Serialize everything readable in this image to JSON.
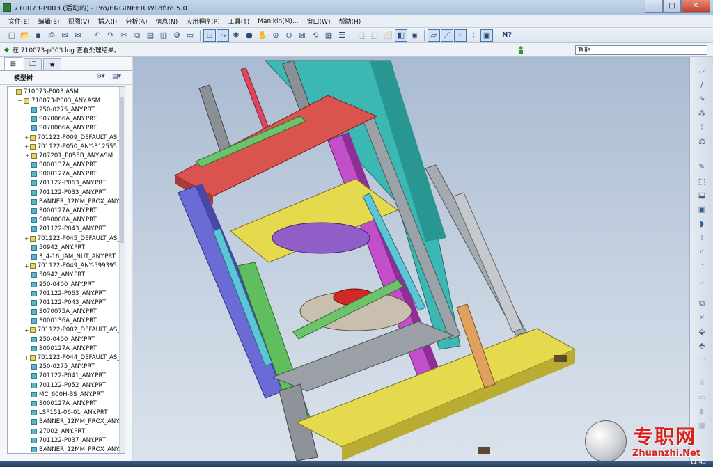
{
  "window": {
    "title": "710073-P003 (活动的) - Pro/ENGINEER Wildfire 5.0",
    "min_label": "–",
    "max_label": "□",
    "close_label": "✕"
  },
  "menu": {
    "items": [
      "文件(E)",
      "编辑(E)",
      "视图(V)",
      "插入(I)",
      "分析(A)",
      "信息(N)",
      "应用程序(P)",
      "工具(T)",
      "Manikin(M)...",
      "窗口(W)",
      "帮助(H)"
    ]
  },
  "toolbar": {
    "icons": [
      "new-icon",
      "open-icon",
      "save-icon",
      "print-icon",
      "email-icon",
      "email-link-icon",
      "undo-icon",
      "redo-icon",
      "cut-icon",
      "copy-icon",
      "paste-icon",
      "paste-special-icon",
      "regenerate-icon",
      "window-icon",
      "spin-center-icon",
      "repaint-icon",
      "orient-icon",
      "pan-icon",
      "zoom-in-icon",
      "zoom-out-icon",
      "refit-icon",
      "reorient-icon",
      "saved-views-icon",
      "layers-icon",
      "wireframe-icon",
      "hidden-line-icon",
      "no-hidden-icon",
      "shading-icon",
      "enhanced-realism-icon",
      "datum-plane-icon",
      "datum-axis-icon",
      "datum-point-icon",
      "csys-icon",
      "annotation-icon"
    ],
    "help_label": "N?"
  },
  "status": {
    "message": "在 710073-p003.log 查看处理结果。",
    "filter_value": "智能",
    "indicator_color": "#2a9a2a"
  },
  "navigator": {
    "tabs": [
      "model-tree-tab-icon",
      "folder-browser-tab-icon",
      "favorites-tab-icon"
    ],
    "header_label": "模型树",
    "settings_label": "⚙▾",
    "show_label": "▤▾"
  },
  "tree": {
    "rows": [
      {
        "label": "710073-P003.ASM",
        "type": "asm",
        "level": 0,
        "exp": ""
      },
      {
        "label": "710073-P003_ANY.ASM",
        "type": "asm",
        "level": 1,
        "exp": "−"
      },
      {
        "label": "250-0275_ANY.PRT",
        "type": "part",
        "level": 2,
        "exp": ""
      },
      {
        "label": "S070066A_ANY.PRT",
        "type": "part",
        "level": 2,
        "exp": ""
      },
      {
        "label": "S070066A_ANY.PRT",
        "type": "part",
        "level": 2,
        "exp": ""
      },
      {
        "label": "701122-P009_DEFAULT_AS_MA",
        "type": "asm",
        "level": 2,
        "exp": "+"
      },
      {
        "label": "701122-P050_ANY-312555.AS",
        "type": "asm",
        "level": 2,
        "exp": "+"
      },
      {
        "label": "707201_P055B_ANY.ASM",
        "type": "asm",
        "level": 2,
        "exp": "+"
      },
      {
        "label": "S000137A_ANY.PRT",
        "type": "part",
        "level": 2,
        "exp": ""
      },
      {
        "label": "S000127A_ANY.PRT",
        "type": "part",
        "level": 2,
        "exp": ""
      },
      {
        "label": "701122-P063_ANY.PRT",
        "type": "part",
        "level": 2,
        "exp": ""
      },
      {
        "label": "701122-P033_ANY.PRT",
        "type": "part",
        "level": 2,
        "exp": ""
      },
      {
        "label": "BANNER_12MM_PROX_ANY.P",
        "type": "part",
        "level": 2,
        "exp": ""
      },
      {
        "label": "S000127A_ANY.PRT",
        "type": "part",
        "level": 2,
        "exp": ""
      },
      {
        "label": "S090008A_ANY.PRT",
        "type": "part",
        "level": 2,
        "exp": ""
      },
      {
        "label": "701122-P043_ANY.PRT",
        "type": "part",
        "level": 2,
        "exp": ""
      },
      {
        "label": "701122-P045_DEFAULT_AS_MA",
        "type": "asm",
        "level": 2,
        "exp": "+"
      },
      {
        "label": "50942_ANY.PRT",
        "type": "part",
        "level": 2,
        "exp": ""
      },
      {
        "label": "3_4-16_JAM_NUT_ANY.PRT",
        "type": "part",
        "level": 2,
        "exp": ""
      },
      {
        "label": "701122-P049_ANY-599395.AS",
        "type": "asm",
        "level": 2,
        "exp": "+"
      },
      {
        "label": "50942_ANY.PRT",
        "type": "part",
        "level": 2,
        "exp": ""
      },
      {
        "label": "250-0400_ANY.PRT",
        "type": "part",
        "level": 2,
        "exp": ""
      },
      {
        "label": "701122-P063_ANY.PRT",
        "type": "part",
        "level": 2,
        "exp": ""
      },
      {
        "label": "701122-P043_ANY.PRT",
        "type": "part",
        "level": 2,
        "exp": ""
      },
      {
        "label": "S070075A_ANY.PRT",
        "type": "part",
        "level": 2,
        "exp": ""
      },
      {
        "label": "S000136A_ANY.PRT",
        "type": "part",
        "level": 2,
        "exp": ""
      },
      {
        "label": "701122-P002_DEFAULT_AS_MA",
        "type": "asm",
        "level": 2,
        "exp": "+"
      },
      {
        "label": "250-0400_ANY.PRT",
        "type": "part",
        "level": 2,
        "exp": ""
      },
      {
        "label": "S000127A_ANY.PRT",
        "type": "part",
        "level": 2,
        "exp": ""
      },
      {
        "label": "701122-P044_DEFAULT_AS_MA",
        "type": "asm",
        "level": 2,
        "exp": "+"
      },
      {
        "label": "250-0275_ANY.PRT",
        "type": "part",
        "level": 2,
        "exp": ""
      },
      {
        "label": "701122-P041_ANY.PRT",
        "type": "part",
        "level": 2,
        "exp": ""
      },
      {
        "label": "701122-P052_ANY.PRT",
        "type": "part",
        "level": 2,
        "exp": ""
      },
      {
        "label": "MC_600H-BS_ANY.PRT",
        "type": "part",
        "level": 2,
        "exp": ""
      },
      {
        "label": "S000127A_ANY.PRT",
        "type": "part",
        "level": 2,
        "exp": ""
      },
      {
        "label": "LSP151-06-01_ANY.PRT",
        "type": "part",
        "level": 2,
        "exp": ""
      },
      {
        "label": "BANNER_12MM_PROX_ANY.P",
        "type": "part",
        "level": 2,
        "exp": ""
      },
      {
        "label": "27002_ANY.PRT",
        "type": "part",
        "level": 2,
        "exp": ""
      },
      {
        "label": "701122-P037_ANY.PRT",
        "type": "part",
        "level": 2,
        "exp": ""
      },
      {
        "label": "BANNER_12MM_PROX_ANY.P",
        "type": "part",
        "level": 2,
        "exp": ""
      }
    ]
  },
  "right_toolbar": {
    "icons": [
      {
        "name": "datum-plane-icon",
        "glyph": "▱"
      },
      {
        "name": "datum-axis-icon",
        "glyph": "/"
      },
      {
        "name": "sketched-curve-icon",
        "glyph": "∿"
      },
      {
        "name": "datum-point-icon",
        "glyph": "⁂"
      },
      {
        "name": "csys-icon",
        "glyph": "⊹"
      },
      {
        "name": "analysis-feature-icon",
        "glyph": "⚖"
      },
      {
        "name": "sketch-icon",
        "glyph": "✎"
      },
      {
        "name": "component-icon",
        "glyph": "⬚"
      },
      {
        "name": "create-component-icon",
        "glyph": "⬓"
      },
      {
        "name": "extrude-icon",
        "glyph": "▣"
      },
      {
        "name": "revolve-icon",
        "glyph": "◗"
      },
      {
        "name": "hole-icon",
        "glyph": "⊤"
      },
      {
        "name": "round-icon",
        "glyph": "◜"
      },
      {
        "name": "chamfer-icon",
        "glyph": "◝"
      },
      {
        "name": "draft-icon",
        "glyph": "◞"
      },
      {
        "name": "pattern-icon",
        "glyph": "⧉"
      },
      {
        "name": "mirror-icon",
        "glyph": "⧖"
      },
      {
        "name": "merge-icon",
        "glyph": "⬙"
      },
      {
        "name": "trim-icon",
        "glyph": "⬘"
      },
      {
        "name": "offset-icon",
        "glyph": "◠"
      },
      {
        "name": "intersect-icon",
        "glyph": "⋔"
      },
      {
        "name": "thicken-icon",
        "glyph": "▭"
      },
      {
        "name": "solidify-icon",
        "glyph": "▮"
      },
      {
        "name": "project-icon",
        "glyph": "▦"
      }
    ]
  },
  "watermark": {
    "cn": "专职网",
    "en": "Zhuanzhi.Net"
  },
  "taskbar": {
    "clock": "11:45"
  }
}
